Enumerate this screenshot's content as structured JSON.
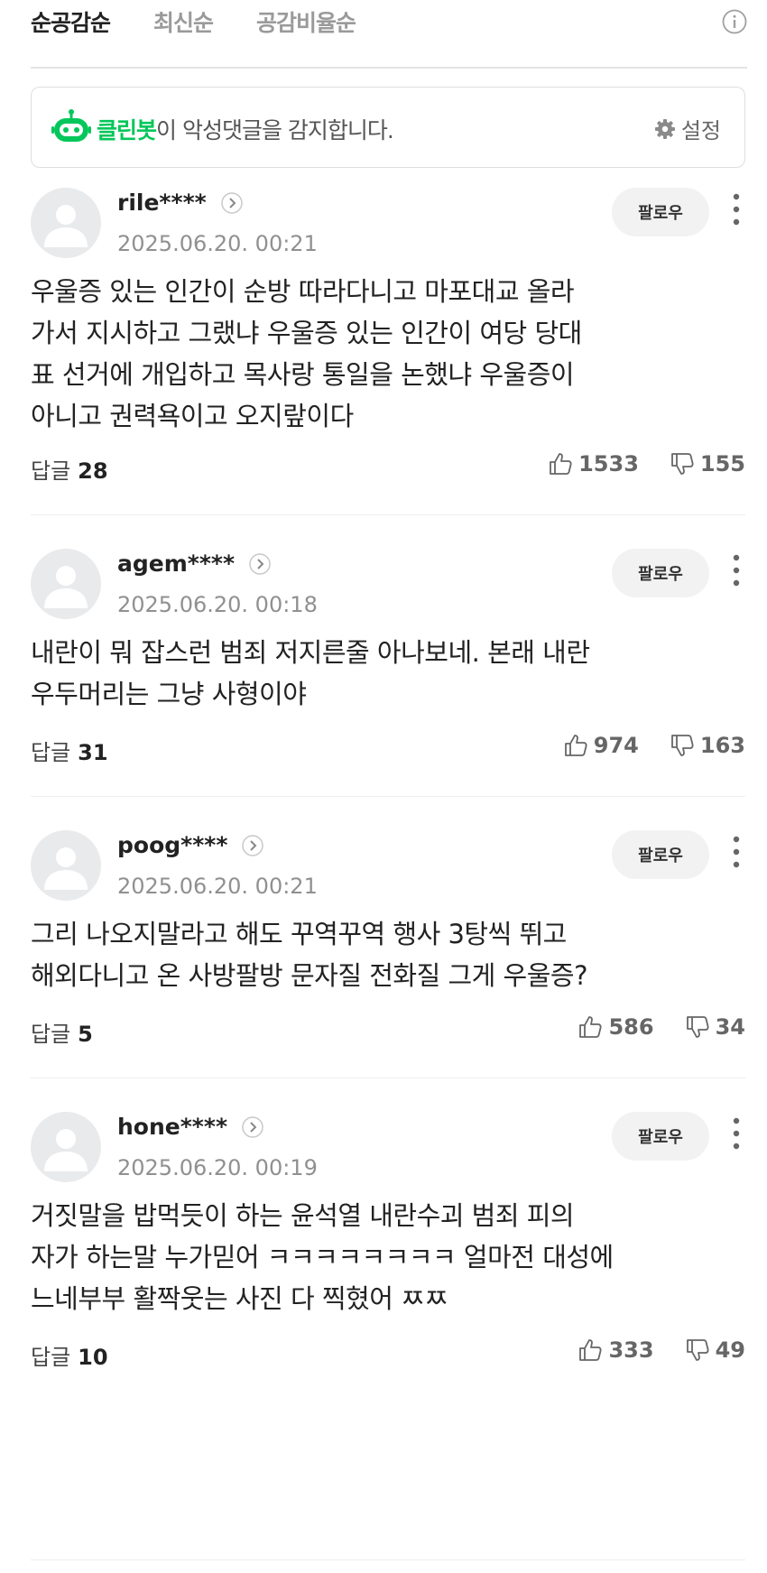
{
  "sort": {
    "tabs": [
      {
        "label": "순공감순",
        "active": true
      },
      {
        "label": "최신순",
        "active": false
      },
      {
        "label": "공감비율순",
        "active": false
      }
    ]
  },
  "cleanbot": {
    "name": "클린봇",
    "message": "이 악성댓글을 감지합니다.",
    "settings_label": "설정",
    "accent": "#03c75a"
  },
  "comments": [
    {
      "user": "rile****",
      "date": "2025.06.20. 00:21",
      "follow_label": "팔로우",
      "lines": [
        "우울증 있는 인간이 순방 따라다니고 마포대교 올라",
        "가서 지시하고 그랬냐 우울증 있는 인간이 여당 당대",
        "표 선거에 개입하고 목사랑 통일을 논했냐 우울증이",
        "아니고 권력욕이고 오지랖이다"
      ],
      "reply_label": "답글",
      "reply_count": "28",
      "likes": "1533",
      "dislikes": "155"
    },
    {
      "user": "agem****",
      "date": "2025.06.20. 00:18",
      "follow_label": "팔로우",
      "lines": [
        "내란이 뭐 잡스런 범죄 저지른줄 아나보네. 본래 내란",
        "우두머리는 그냥 사형이야"
      ],
      "reply_label": "답글",
      "reply_count": "31",
      "likes": "974",
      "dislikes": "163"
    },
    {
      "user": "poog****",
      "date": "2025.06.20. 00:21",
      "follow_label": "팔로우",
      "lines": [
        "그리 나오지말라고 해도 꾸역꾸역 행사 3탕씩 뛰고",
        "해외다니고 온 사방팔방 문자질 전화질 그게 우울증?"
      ],
      "reply_label": "답글",
      "reply_count": "5",
      "likes": "586",
      "dislikes": "34"
    },
    {
      "user": "hone****",
      "date": "2025.06.20. 00:19",
      "follow_label": "팔로우",
      "lines": [
        "거짓말을 밥먹듯이 하는 윤석열 내란수괴 범죄 피의",
        "자가 하는말 누가믿어 ㅋㅋㅋㅋㅋㅋㅋㅋ 얼마전 대성에",
        "느네부부 활짝웃는 사진 다 찍혔어 ㅉㅉ"
      ],
      "reply_label": "답글",
      "reply_count": "10",
      "likes": "333",
      "dislikes": "49"
    }
  ]
}
